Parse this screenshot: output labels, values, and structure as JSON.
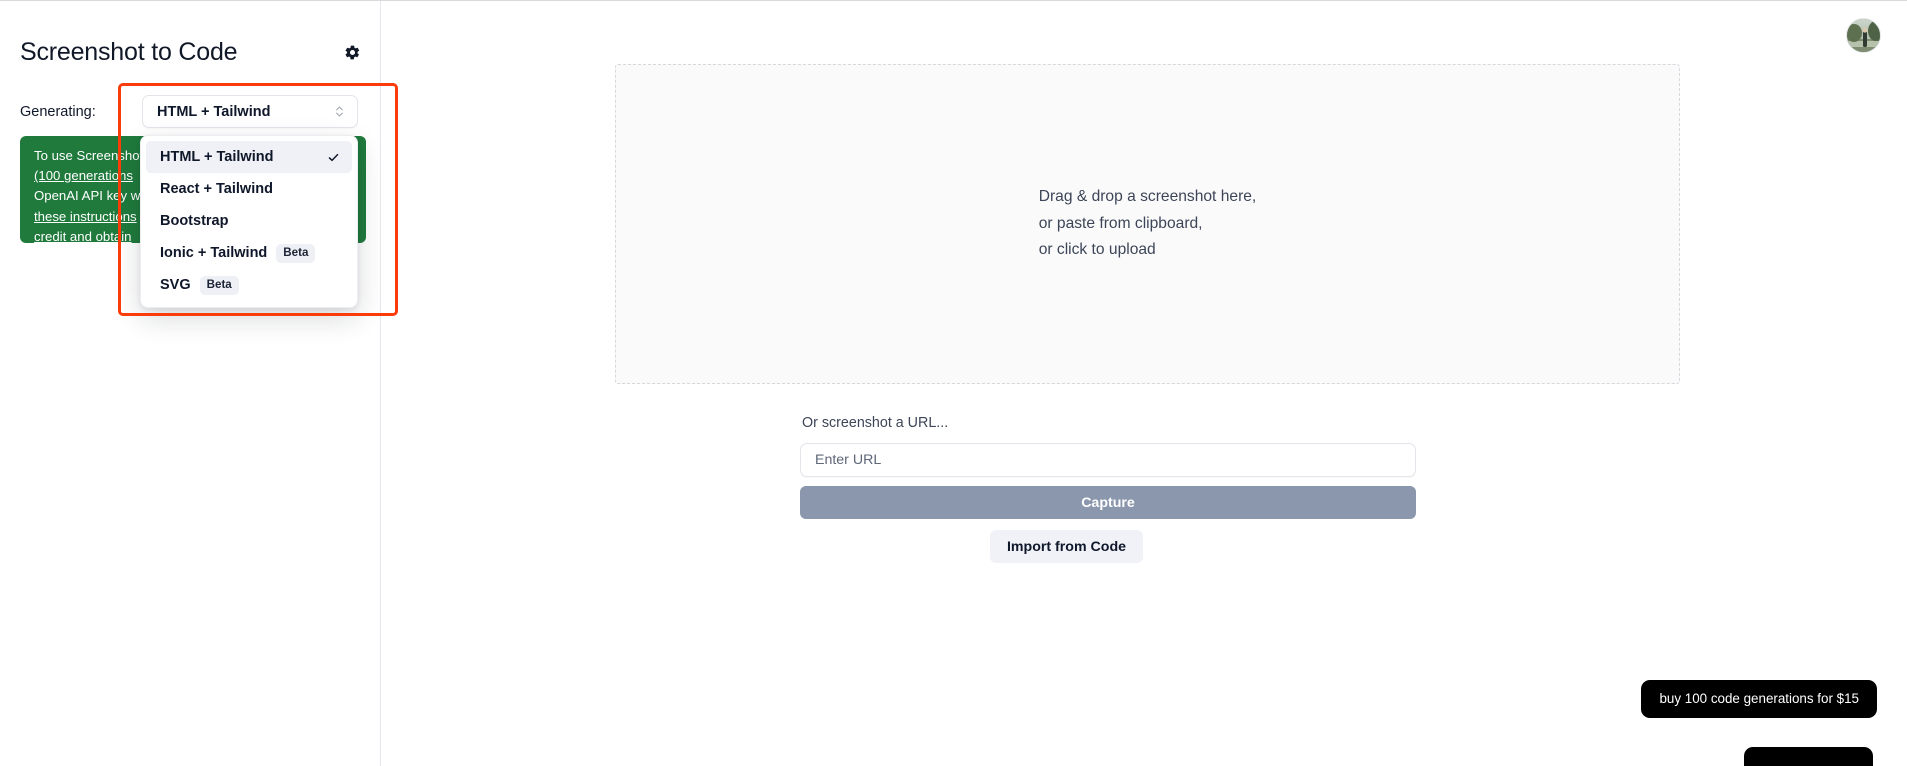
{
  "app": {
    "title": "Screenshot to Code"
  },
  "sidebar": {
    "settings_icon": "gear-icon",
    "generating": {
      "label": "Generating:",
      "selected_value": "HTML + Tailwind",
      "trigger_icon": "chevron-up-down-icon"
    },
    "stack_options": [
      {
        "label": "HTML + Tailwind",
        "badge": "",
        "selected": true
      },
      {
        "label": "React + Tailwind",
        "badge": "",
        "selected": false
      },
      {
        "label": "Bootstrap",
        "badge": "",
        "selected": false
      },
      {
        "label": "Ionic + Tailwind",
        "badge": "Beta",
        "selected": false
      },
      {
        "label": "SVG",
        "badge": "Beta",
        "selected": false
      }
    ],
    "api_notice": {
      "line1": "To use Screenshot to Code",
      "link1": "(100 generations",
      "line2": "OpenAI API key w",
      "link2": "these instructions",
      "link3": "credit and obtain",
      "background_color": "#1f7a3c"
    }
  },
  "annotation": {
    "color": "#fa3c0a",
    "name": "red-highlight-rectangle"
  },
  "main": {
    "dropzone": {
      "line1": "Drag & drop a screenshot here,",
      "line2": "or paste from clipboard,",
      "line3": "or click to upload"
    },
    "url_section": {
      "label": "Or screenshot a URL...",
      "input_value": "",
      "input_placeholder": "Enter URL",
      "capture_label": "Capture",
      "capture_color": "#8b97ad"
    },
    "import_label": "Import from Code"
  },
  "header": {
    "avatar": "user-avatar"
  },
  "overlays": {
    "buy_pill": "buy 100 code generations for $15"
  }
}
